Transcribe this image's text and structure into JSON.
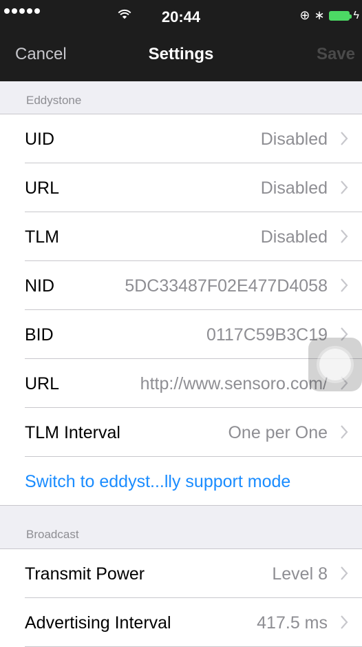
{
  "status_bar": {
    "time": "20:44",
    "signal_icon": "signal-dots-icon",
    "wifi_icon": "wifi-icon",
    "lock_icon": "rotation-lock-icon",
    "bluetooth_icon": "bluetooth-icon",
    "battery_icon": "battery-icon",
    "lock_glyph": "⊕",
    "bluetooth_glyph": "∗",
    "bolt_glyph": "ϟ"
  },
  "nav": {
    "cancel": "Cancel",
    "title": "Settings",
    "save": "Save"
  },
  "sections": {
    "eddystone": {
      "header": "Eddystone",
      "rows": [
        {
          "label": "UID",
          "value": "Disabled"
        },
        {
          "label": "URL",
          "value": "Disabled"
        },
        {
          "label": "TLM",
          "value": "Disabled"
        },
        {
          "label": "NID",
          "value": "5DC33487F02E477D4058"
        },
        {
          "label": "BID",
          "value": "0117C59B3C19"
        },
        {
          "label": "URL",
          "value": "http://www.sensoro.com/"
        },
        {
          "label": "TLM Interval",
          "value": "One per One"
        }
      ],
      "link": "Switch to eddyst...lly support mode"
    },
    "broadcast": {
      "header": "Broadcast",
      "rows": [
        {
          "label": "Transmit Power",
          "value": "Level 8"
        },
        {
          "label": "Advertising Interval",
          "value": "417.5 ms"
        }
      ]
    }
  },
  "colors": {
    "nav_background": "#1d1d1d",
    "link": "#1a8cff",
    "secondary_text": "#8e8e93",
    "battery": "#4cd964"
  }
}
